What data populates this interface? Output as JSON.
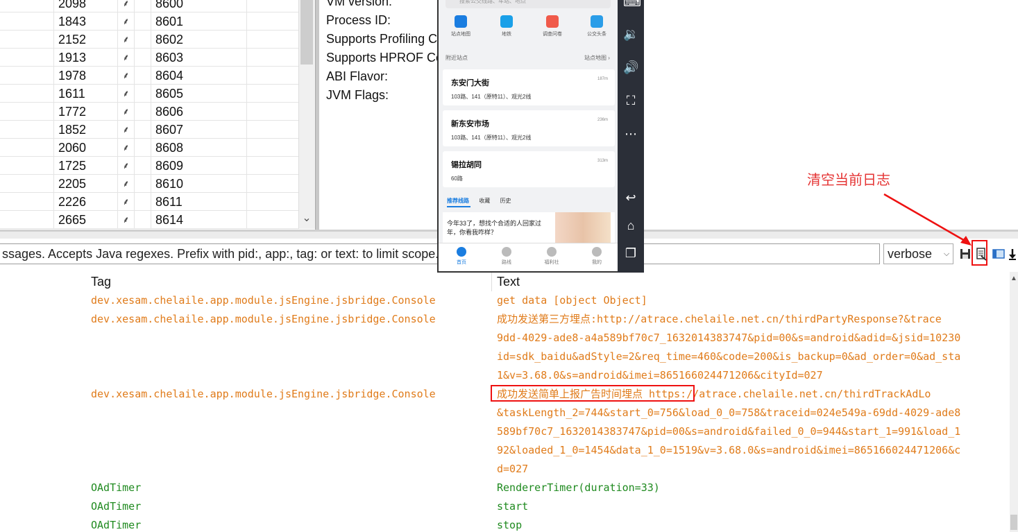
{
  "process_table": {
    "rows": [
      {
        "pid": "2098",
        "port": "8600"
      },
      {
        "pid": "1843",
        "port": "8601"
      },
      {
        "pid": "2152",
        "port": "8602"
      },
      {
        "pid": "1913",
        "port": "8603"
      },
      {
        "pid": "1978",
        "port": "8604"
      },
      {
        "pid": "1611",
        "port": "8605"
      },
      {
        "pid": "1772",
        "port": "8606"
      },
      {
        "pid": "1852",
        "port": "8607"
      },
      {
        "pid": "2060",
        "port": "8608"
      },
      {
        "pid": "1725",
        "port": "8609"
      },
      {
        "pid": "2205",
        "port": "8610"
      },
      {
        "pid": "2226",
        "port": "8611"
      },
      {
        "pid": "2665",
        "port": "8614"
      }
    ],
    "debug_icon": "bug-icon"
  },
  "vm_info": {
    "lines": [
      "VM version:",
      "Process ID:",
      "Supports Profiling C",
      "Supports HPROF Co",
      "ABI Flavor:",
      "JVM Flags:"
    ]
  },
  "filter": {
    "text": "ssages. Accepts Java regexes. Prefix with pid:, app:, tag: or text: to limit scope."
  },
  "log_level": {
    "selected": "verbose"
  },
  "toolbar": {
    "icons": [
      "save-icon",
      "clear-log-icon",
      "split-view-icon",
      "scroll-lock-icon"
    ]
  },
  "annotation": {
    "label": "清空当前日志"
  },
  "log_table": {
    "headers": {
      "tag": "Tag",
      "text": "Text"
    },
    "lines": [
      {
        "tag": "dev.xesam.chelaile.app.module.jsEngine.jsbridge.Console",
        "text": "get data [object Object]",
        "color": "orange"
      },
      {
        "tag": "dev.xesam.chelaile.app.module.jsEngine.jsbridge.Console",
        "text": "成功发送第三方埋点:http://atrace.chelaile.net.cn/thirdPartyResponse?&trace",
        "color": "orange"
      },
      {
        "tag": "",
        "text": "9dd-4029-ade8-a4a589bf70c7_1632014383747&pid=00&s=android&adid=&jsid=10230",
        "color": "orange"
      },
      {
        "tag": "",
        "text": "id=sdk_baidu&adStyle=2&req_time=460&code=200&is_backup=0&ad_order=0&ad_sta",
        "color": "orange"
      },
      {
        "tag": "",
        "text": "1&v=3.68.0&s=android&imei=865166024471206&cityId=027",
        "color": "orange"
      },
      {
        "tag": "dev.xesam.chelaile.app.module.jsEngine.jsbridge.Console",
        "text": "成功发送简单上报广告时间埋点 https://atrace.chelaile.net.cn/thirdTrackAdLo",
        "color": "orange"
      },
      {
        "tag": "",
        "text": "&taskLength_2=744&start_0=756&load_0_0=758&traceid=024e549a-69dd-4029-ade8",
        "color": "orange"
      },
      {
        "tag": "",
        "text": "589bf70c7_1632014383747&pid=00&s=android&failed_0_0=944&start_1=991&load_1",
        "color": "orange"
      },
      {
        "tag": "",
        "text": "92&loaded_1_0=1454&data_1_0=1519&v=3.68.0&s=android&imei=865166024471206&c",
        "color": "orange"
      },
      {
        "tag": "",
        "text": "d=027",
        "color": "orange"
      },
      {
        "tag": "OAdTimer",
        "text": "RendererTimer(duration=33)",
        "color": "green"
      },
      {
        "tag": "OAdTimer",
        "text": "start",
        "color": "green"
      },
      {
        "tag": "OAdTimer",
        "text": "stop",
        "color": "green"
      }
    ]
  },
  "phone": {
    "search_placeholder": "搜索公交线路、车站、地点",
    "quick_items": [
      "站点地图",
      "地铁",
      "调查问卷",
      "公交头条"
    ],
    "nearby_header": "附近站点",
    "nearby_map_link": "站点地图 ›",
    "stations": [
      {
        "name": "东安门大街",
        "lines": "103路、141（原特11）、观光2线",
        "distance": "187m"
      },
      {
        "name": "新东安市场",
        "lines": "103路、141（原特11）、观光2线",
        "distance": "236m"
      },
      {
        "name": "锡拉胡同",
        "lines": "60路",
        "distance": "313m"
      }
    ],
    "tabs": [
      "推荐线路",
      "收藏",
      "历史"
    ],
    "promo_text": "今年33了，想找个合适的人回家过年，你看我咋样？",
    "bottom_nav": [
      "首页",
      "路线",
      "福利社",
      "我的"
    ]
  },
  "emulator": {
    "icons": [
      "keyboard-icon",
      "volume-down-icon",
      "volume-up-icon",
      "screenshot-icon",
      "more-icon",
      "back-icon",
      "home-icon",
      "recents-icon"
    ]
  }
}
